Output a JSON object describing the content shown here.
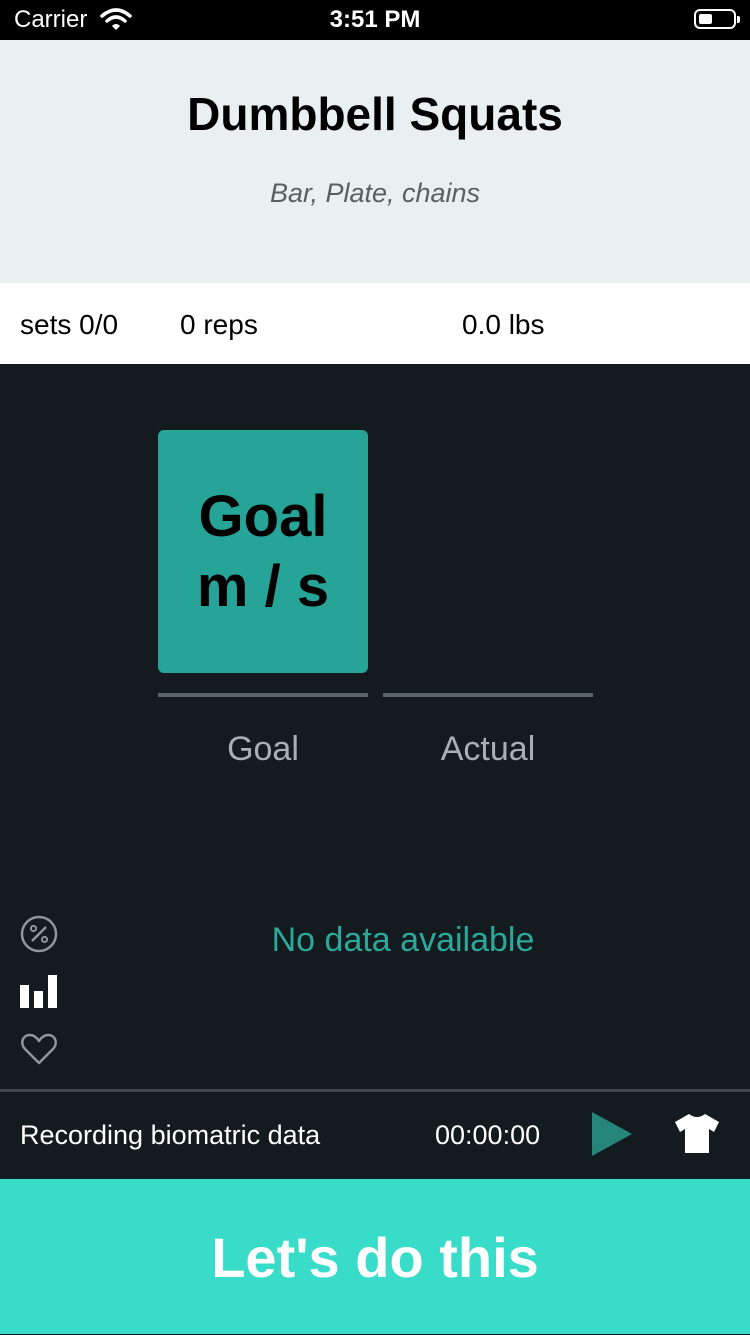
{
  "status_bar": {
    "carrier": "Carrier",
    "time": "3:51 PM",
    "battery_level": 0.4
  },
  "header": {
    "title": "Dumbbell Squats",
    "subtitle": "Bar, Plate, chains"
  },
  "stats": {
    "sets": "sets 0/0",
    "reps": "0 reps",
    "weight": "0.0 lbs"
  },
  "goal_card": {
    "line1": "Goal",
    "line2": "m / s"
  },
  "tabs": {
    "goal": "Goal",
    "actual": "Actual"
  },
  "chart": {
    "empty_message": "No data available"
  },
  "side_icons": [
    "percent-icon",
    "bar-chart-icon",
    "heart-icon"
  ],
  "recording": {
    "label": "Recording biomatric data",
    "timer": "00:00:00"
  },
  "cta": {
    "label": "Let's do this"
  },
  "colors": {
    "accent": "#26a497",
    "cta": "#38dcc8",
    "background": "#131b1f"
  }
}
